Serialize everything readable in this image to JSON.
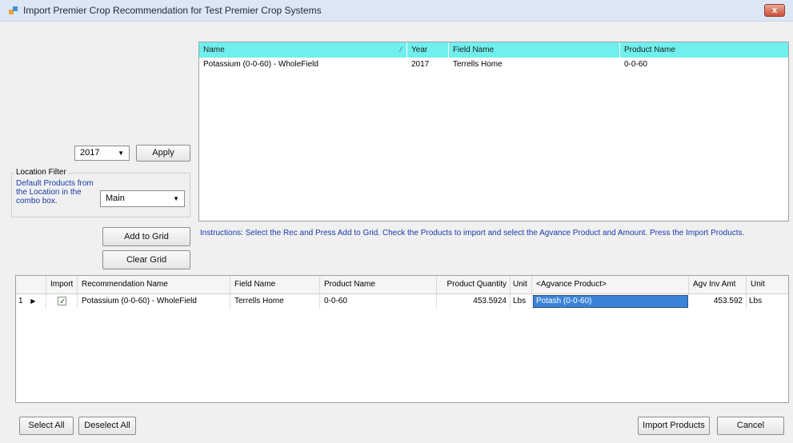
{
  "window": {
    "title": "Import Premier Crop Recommendation for Test Premier Crop Systems",
    "close_glyph": "x"
  },
  "year_filter": {
    "selected": "2017",
    "apply_label": "Apply"
  },
  "location_filter": {
    "legend": "Location Filter",
    "description": "Default Products from the Location in the combo box.",
    "selected": "Main"
  },
  "top_grid": {
    "columns": [
      "Name",
      "Year",
      "Field Name",
      "Product Name"
    ],
    "rows": [
      {
        "name": "Potassium (0-0-60) - WholeField",
        "year": "2017",
        "field_name": "Terrells Home",
        "product_name": "0-0-60"
      }
    ]
  },
  "actions": {
    "add_to_grid": "Add to Grid",
    "clear_grid": "Clear Grid",
    "select_all": "Select All",
    "deselect_all": "Deselect All",
    "import_products": "Import Products",
    "cancel": "Cancel"
  },
  "instructions": "Instructions:  Select the Rec and Press Add to Grid.  Check the Products to import and select the Agvance Product and Amount.  Press the Import Products.",
  "bottom_grid": {
    "columns": [
      "Import",
      "Recommendation Name",
      "Field Name",
      "Product Name",
      "Product Quantity",
      "Unit",
      "<Agvance Product>",
      "Agv Inv Amt",
      "Unit"
    ],
    "rows": [
      {
        "row_number": "1",
        "row_indicator": "▶",
        "import_checked": true,
        "check_glyph": "✓",
        "recommendation_name": "Potassium (0-0-60) - WholeField",
        "field_name": "Terrells Home",
        "product_name": "0-0-60",
        "product_quantity": "453.5924",
        "unit": "Lbs",
        "agvance_product": "Potash (0-0-60)",
        "agv_inv_amt": "453.592",
        "agv_unit": "Lbs"
      }
    ]
  },
  "colors": {
    "header_cyan": "#6ff0ee",
    "selection_blue": "#3a83d8",
    "instruction_blue": "#1a3aa8"
  }
}
